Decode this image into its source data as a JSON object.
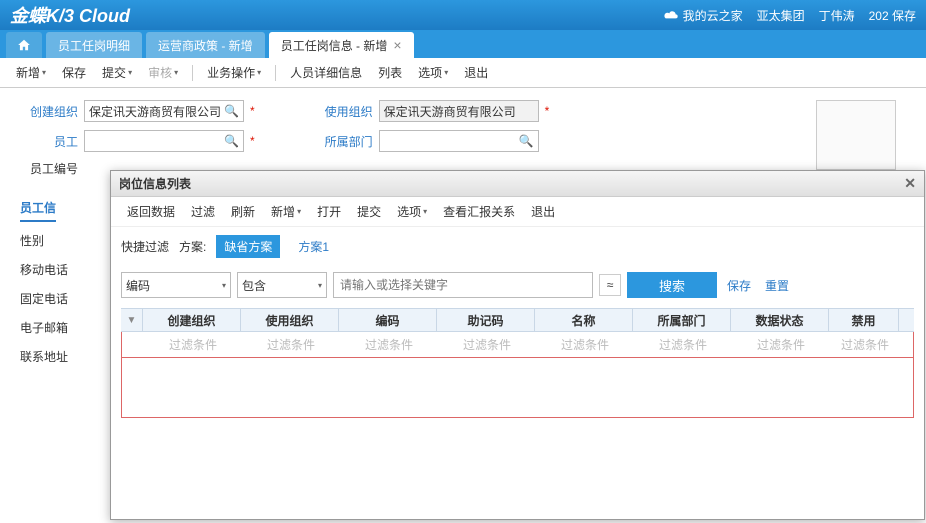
{
  "header": {
    "logo": "金蝶K/3 Cloud",
    "cloud_link": "我的云之家",
    "org": "亚太集团",
    "user": "丁伟涛",
    "msg_count": "202",
    "msg_label": "保存"
  },
  "tabs": {
    "t1": "员工任岗明细",
    "t2": "运营商政策 - 新增",
    "t3": "员工任岗信息 - 新增"
  },
  "toolbar": {
    "new": "新增",
    "save": "保存",
    "submit": "提交",
    "audit": "审核",
    "bizop": "业务操作",
    "detail": "人员详细信息",
    "list": "列表",
    "option": "选项",
    "exit": "退出"
  },
  "form": {
    "create_org_label": "创建组织",
    "create_org_value": "保定讯天游商贸有限公司",
    "employee_label": "员工",
    "employee_no_label": "员工编号",
    "use_org_label": "使用组织",
    "use_org_value": "保定讯天游商贸有限公司",
    "dept_label": "所属部门",
    "req": "*"
  },
  "subtab": {
    "label": "员工信"
  },
  "side": {
    "l1": "性别",
    "l2": "移动电话",
    "l3": "固定电话",
    "l4": "电子邮箱",
    "l5": "联系地址"
  },
  "dialog": {
    "title": "岗位信息列表",
    "toolbar": {
      "back": "返回数据",
      "filter": "过滤",
      "refresh": "刷新",
      "new": "新增",
      "open": "打开",
      "submit": "提交",
      "option": "选项",
      "report": "查看汇报关系",
      "exit": "退出"
    },
    "quick_filter_label": "快捷过滤",
    "scheme_label": "方案:",
    "scheme_default": "缺省方案",
    "scheme1": "方案1",
    "sel_field": "编码",
    "sel_op": "包含",
    "search_placeholder": "请输入或选择关键字",
    "search_btn": "搜索",
    "save_link": "保存",
    "reset_link": "重置",
    "cols": {
      "c1": "创建组织",
      "c2": "使用组织",
      "c3": "编码",
      "c4": "助记码",
      "c5": "名称",
      "c6": "所属部门",
      "c7": "数据状态",
      "c8": "禁用"
    },
    "filter_ph": "过滤条件"
  },
  "tri": "▾",
  "tri_r": "▸"
}
